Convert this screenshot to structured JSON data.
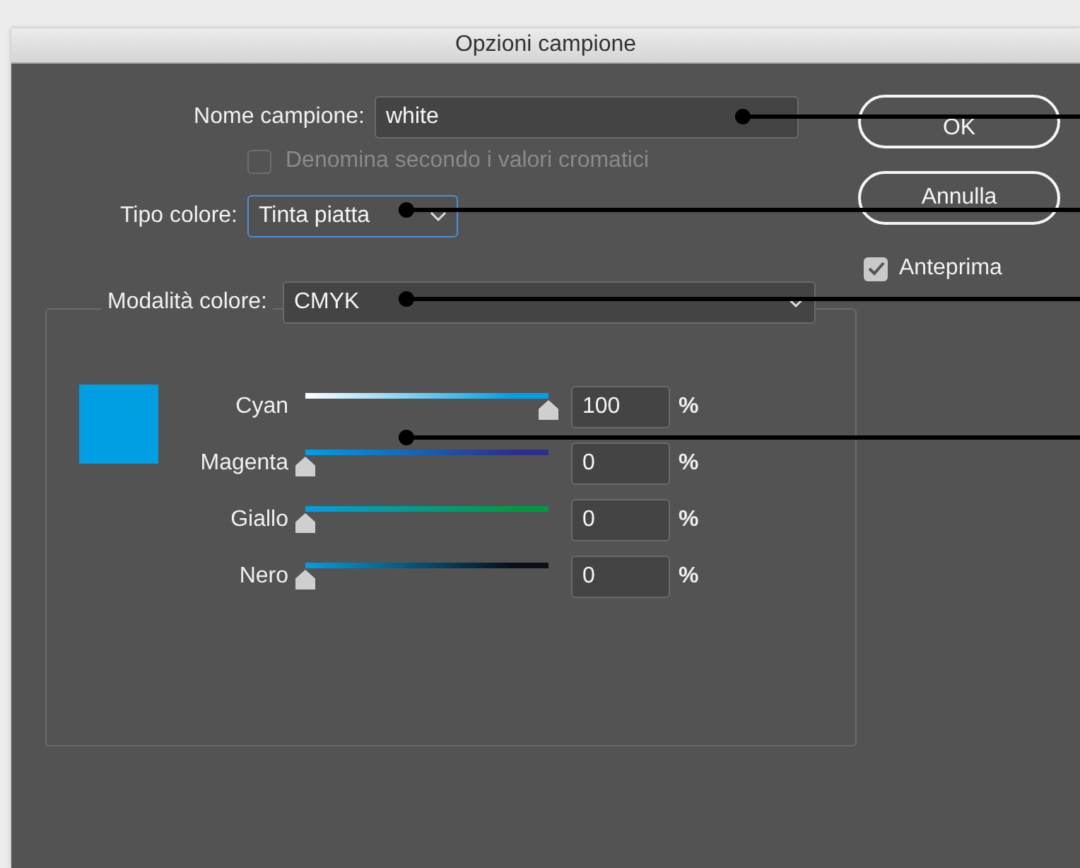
{
  "window": {
    "title": "Opzioni campione"
  },
  "name_field": {
    "label": "Nome campione:",
    "value": "white"
  },
  "name_by_value": {
    "label": "Denomina secondo i valori cromatici",
    "checked": false,
    "disabled": true
  },
  "color_type": {
    "label": "Tipo colore:",
    "value": "Tinta piatta"
  },
  "color_mode": {
    "label": "Modalità colore:",
    "value": "CMYK"
  },
  "swatch": {
    "color": "#009fe3"
  },
  "channels": [
    {
      "name": "Cyan",
      "level": 1,
      "value": "100",
      "unit": "%",
      "color": "#00a0e4"
    },
    {
      "name": "Magenta",
      "level": 0,
      "value": "0",
      "unit": "%",
      "color": "#2c2f8c"
    },
    {
      "name": "Giallo",
      "level": 0,
      "value": "0",
      "unit": "%",
      "color": "#009a45"
    },
    {
      "name": "Nero",
      "level": 0,
      "value": "0",
      "unit": "%",
      "color": "#0a0f18"
    }
  ],
  "buttons": [
    "OK",
    "Annulla"
  ],
  "preview": {
    "label": "Anteprima",
    "checked": true
  }
}
